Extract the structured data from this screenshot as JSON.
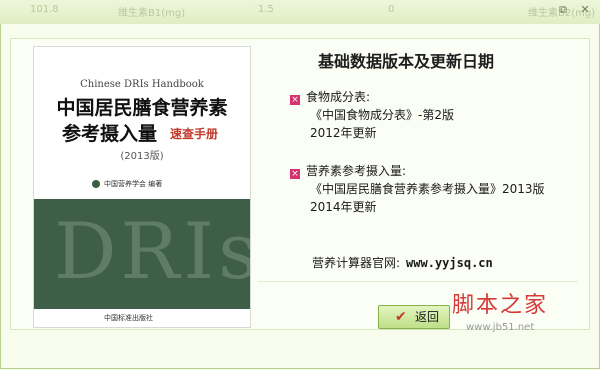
{
  "titlebar": {
    "columns": [
      "101.8",
      "维生素B1(mg)",
      "1.5",
      "0",
      "维生素B2(mg)"
    ]
  },
  "cover": {
    "english_title": "Chinese DRIs Handbook",
    "title_line1": "中国居民膳食营养素",
    "title_line2": "参考摄入量",
    "subtitle_red": "速查手册",
    "edition": "(2013版)",
    "society": "中国营养学会 编著",
    "band_text": "DRIs",
    "publisher": "中国标准出版社"
  },
  "panel": {
    "heading": "基础数据版本及更新日期",
    "food": {
      "label": "食物成分表:",
      "source": "《中国食物成分表》-第2版",
      "updated": "2012年更新"
    },
    "dri": {
      "label": "营养素参考摄入量:",
      "source": "《中国居民膳食营养素参考摄入量》2013版",
      "updated": "2014年更新"
    },
    "site_label": "营养计算器官网:",
    "site_url": "www.yyjsq.cn"
  },
  "buttons": {
    "back_label": "返回"
  },
  "watermark": {
    "cn": "脚本之家",
    "url": "www.jb51.net"
  }
}
